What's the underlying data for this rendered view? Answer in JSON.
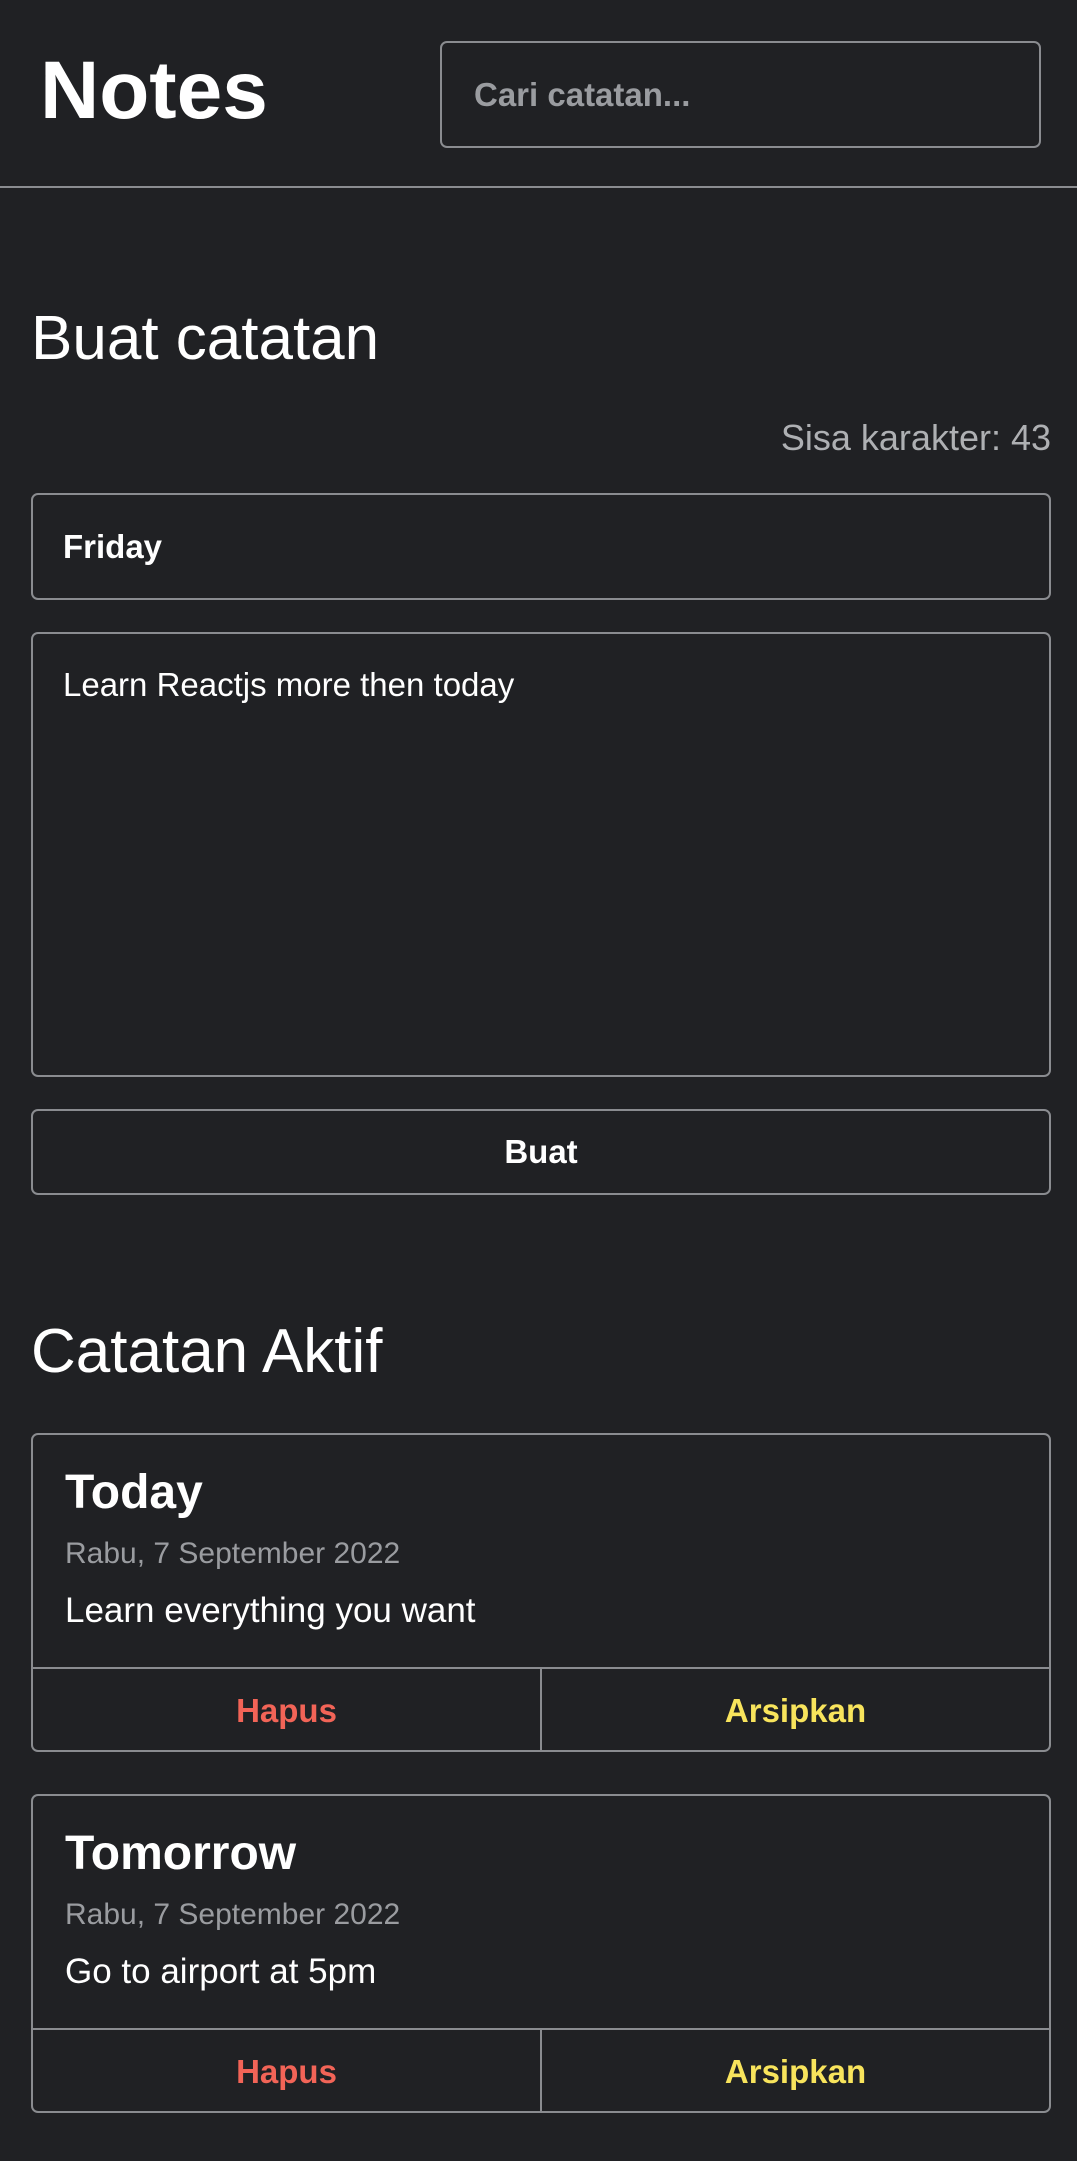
{
  "header": {
    "title": "Notes",
    "search_placeholder": "Cari catatan..."
  },
  "create": {
    "heading": "Buat catatan",
    "char_count": "Sisa karakter: 43",
    "title_value": "Friday",
    "body_value": "Learn Reactjs more then today",
    "submit_label": "Buat"
  },
  "active": {
    "heading": "Catatan Aktif",
    "notes": [
      {
        "title": "Today",
        "date": "Rabu, 7 September 2022",
        "body": "Learn everything you want",
        "delete_label": "Hapus",
        "archive_label": "Arsipkan"
      },
      {
        "title": "Tomorrow",
        "date": "Rabu, 7 September 2022",
        "body": "Go to airport at 5pm",
        "delete_label": "Hapus",
        "archive_label": "Arsipkan"
      }
    ]
  },
  "colors": {
    "background": "#202124",
    "border": "#8a8c90",
    "delete": "#f26457",
    "archive": "#f8e45c",
    "muted_text": "#9a9ca0"
  }
}
